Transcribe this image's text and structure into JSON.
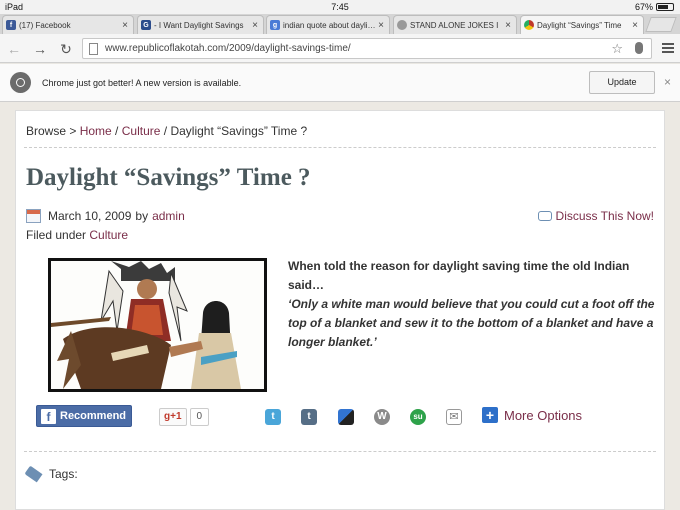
{
  "status_bar": {
    "device": "iPad",
    "time": "7:45",
    "battery": "67%"
  },
  "tabs": [
    {
      "title": "(17) Facebook",
      "active": false,
      "favicon_color": "#3b5998",
      "favicon_glyph": "f"
    },
    {
      "title": "- I Want Daylight Savings",
      "active": false,
      "favicon_color": "#2b4c8c",
      "favicon_glyph": "G"
    },
    {
      "title": "indian quote about dayligh",
      "active": false,
      "favicon_color": "#4a7bd6",
      "favicon_glyph": "g"
    },
    {
      "title": "STAND ALONE JOKES I",
      "active": false,
      "favicon_color": "#999999",
      "favicon_glyph": ""
    },
    {
      "title": "Daylight “Savings” Time",
      "active": true,
      "favicon_color": "#c0392b",
      "favicon_glyph": ""
    }
  ],
  "omnibox": {
    "url": "www.republicoflakotah.com/2009/daylight-savings-time/"
  },
  "infobar": {
    "message": "Chrome just got better! A new version is available.",
    "button": "Update"
  },
  "breadcrumb": {
    "prefix": "Browse > ",
    "home": "Home",
    "sep1": " / ",
    "category": "Culture",
    "sep2": " / ",
    "current": "Daylight “Savings” Time ?"
  },
  "post": {
    "title": "Daylight “Savings” Time ?",
    "date": "March 10, 2009",
    "by": "by",
    "author": "admin",
    "filed_prefix": "Filed under",
    "filed_category": "Culture",
    "discuss": "Discuss This Now!",
    "quote_intro": "When told the reason for daylight saving time the old Indian said…",
    "quote_body": "‘Only a white man would believe that you could cut a foot off the top of a blanket and sew it to the bottom of a blanket and have a longer blanket.’"
  },
  "share": {
    "recommend": "Recommend",
    "gplus": "+1",
    "gplus_count": "0",
    "more": "More Options",
    "icons": [
      {
        "name": "twitter-icon",
        "color": "#4aa6d9",
        "glyph": "t"
      },
      {
        "name": "tumblr-icon",
        "color": "#566e86",
        "glyph": "t"
      },
      {
        "name": "delicious-icon",
        "color": "#3274d1",
        "glyph": ""
      },
      {
        "name": "wordpress-icon",
        "color": "#8a8a8a",
        "glyph": "W"
      },
      {
        "name": "stumbleupon-icon",
        "color": "#2ea24a",
        "glyph": "su"
      },
      {
        "name": "email-icon",
        "color": "#8a8a8a",
        "glyph": "✉"
      }
    ]
  },
  "tags": {
    "label": "Tags:"
  },
  "colors": {
    "link": "#7a2e49",
    "title": "#4c5a5e",
    "facebook": "#4b6ca6"
  }
}
